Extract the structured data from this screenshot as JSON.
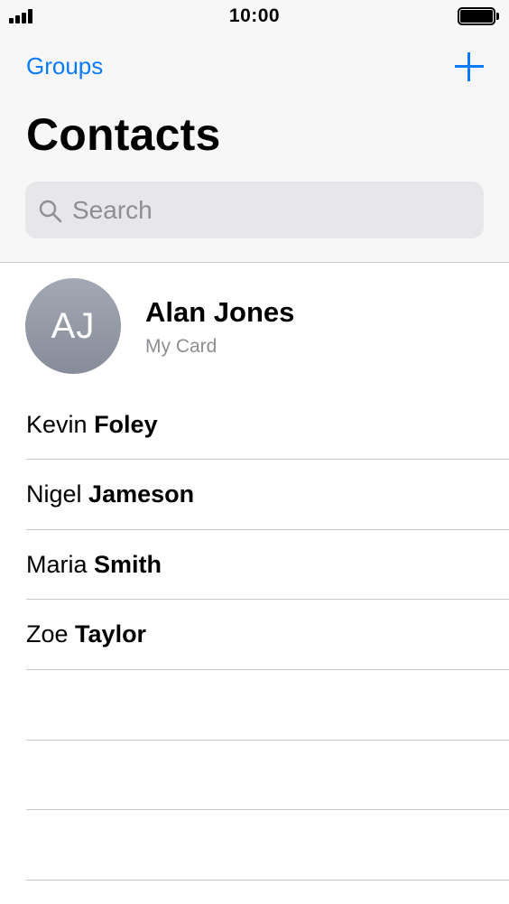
{
  "status_bar": {
    "time": "10:00",
    "signal_icon": "cellular-signal-icon",
    "battery_icon": "battery-full-icon"
  },
  "nav": {
    "groups_label": "Groups",
    "add_icon": "plus-icon"
  },
  "title": "Contacts",
  "search": {
    "placeholder": "Search",
    "icon": "search-icon"
  },
  "my_card": {
    "initials": "AJ",
    "name": "Alan Jones",
    "subtitle": "My Card"
  },
  "contacts": [
    {
      "first": "Kevin",
      "last": "Foley"
    },
    {
      "first": "Nigel",
      "last": "Jameson"
    },
    {
      "first": "Maria",
      "last": "Smith"
    },
    {
      "first": "Zoe",
      "last": "Taylor"
    }
  ],
  "colors": {
    "accent": "#0a7aff",
    "header_bg": "#f7f7f7",
    "search_bg": "#e7e7ea",
    "secondary_text": "#8e8e93",
    "separator": "#c8c7cc"
  }
}
